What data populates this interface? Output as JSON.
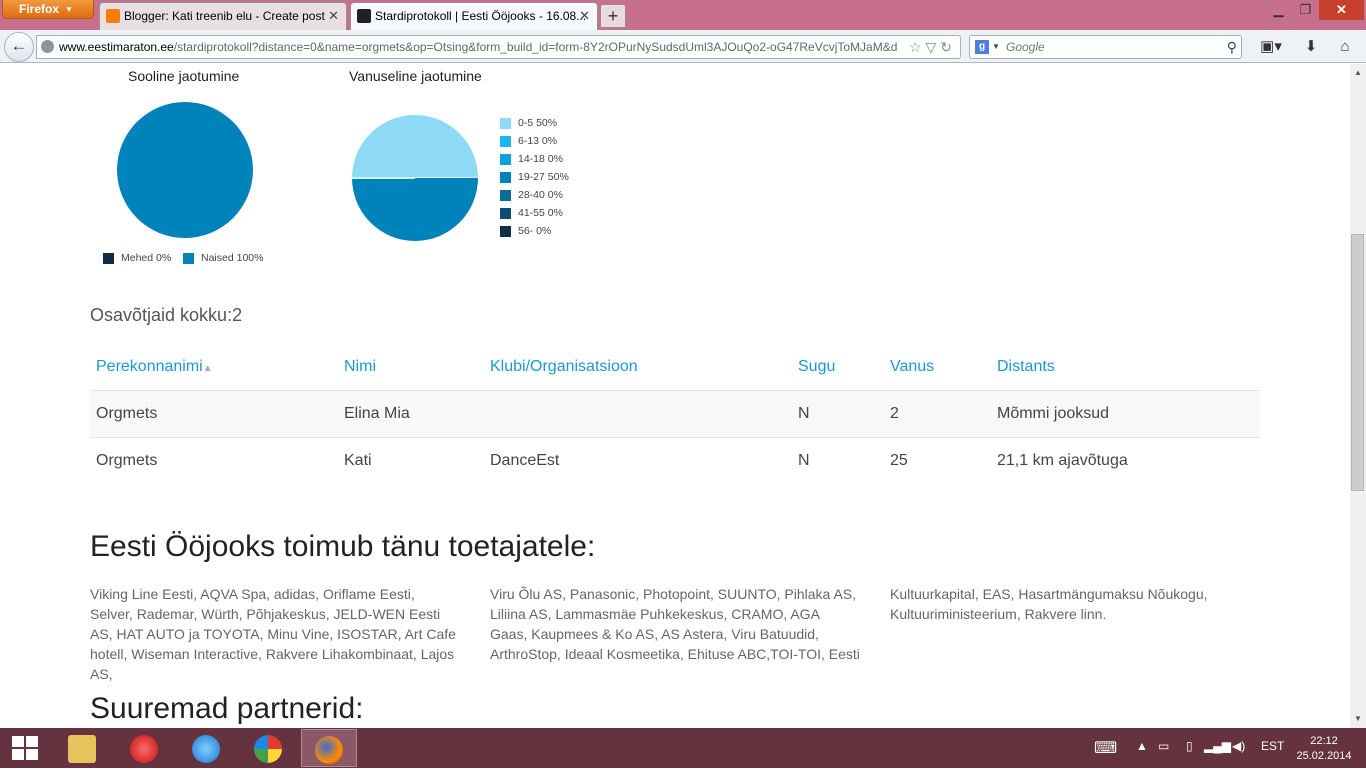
{
  "browser": {
    "app_button": "Firefox",
    "tabs": [
      {
        "title": "Blogger: Kati treenib elu - Create post"
      },
      {
        "title": "Stardiprotokoll | Eesti Ööjooks - 16.08..."
      }
    ],
    "url_host": "www.eestimaraton.ee",
    "url_path": "/stardiprotokoll?distance=0&name=orgmets&op=Otsing&form_build_id=form-8Y2rOPurNySudsdUml3AJOuQo2-oG47ReVcvjToMJaM&d",
    "search_placeholder": "Google"
  },
  "charts": {
    "gender_title": "Sooline jaotumine",
    "age_title": "Vanuseline jaotumine"
  },
  "chart_data": [
    {
      "type": "pie",
      "title": "Sooline jaotumine",
      "labels": [
        "Mehed 0%",
        "Naised 100%"
      ],
      "values": [
        0,
        100
      ],
      "colors": [
        "#0d2b43",
        "#0083ba"
      ],
      "legend": "bottom"
    },
    {
      "type": "pie",
      "title": "Vanuseline jaotumine",
      "labels": [
        "0-5 50%",
        "6-13 0%",
        "14-18 0%",
        "19-27 50%",
        "28-40 0%",
        "41-55 0%",
        "56- 0%"
      ],
      "values": [
        50,
        0,
        0,
        50,
        0,
        0,
        0
      ],
      "colors": [
        "#8dd9f6",
        "#1cb5ee",
        "#0ea3d8",
        "#0083ba",
        "#0b6b9a",
        "#0d4e72",
        "#0c2e49"
      ],
      "legend": "right"
    }
  ],
  "participants_label": "Osavõtjaid kokku:2",
  "table": {
    "headers": [
      "Perekonnanimi",
      "Nimi",
      "Klubi/Organisatsioon",
      "Sugu",
      "Vanus",
      "Distants"
    ],
    "rows": [
      [
        "Orgmets",
        "Elina Mia",
        "",
        "N",
        "2",
        "Mõmmi jooksud"
      ],
      [
        "Orgmets",
        "Kati",
        "DanceEst",
        "N",
        "25",
        "21,1 km ajavõtuga"
      ]
    ]
  },
  "sponsors": {
    "heading": "Eesti Öö­jooks toimub tänu toetajatele:",
    "col1": "Viking Line Eesti, AQVA Spa, adidas, Oriflame Eesti, Selver, Rademar, Würth, Põhjakeskus, JELD-WEN Eesti AS, HAT AUTO ja TOYOTA, Minu Vine, ISOSTAR, Art Cafe hotell, Wiseman Interactive, Rakvere Lihakombinaat, Lajos AS,",
    "col2": "Viru Õlu AS, Panasonic, Photopoint, SUUNTO, Pihlaka AS, Liliina AS, Lammasmäe Puhkekeskus, CRAMO, AGA Gaas, Kaupmees & Ko AS, AS Astera, Viru Batuudid, ArthroStop, Ideaal Kosmeetika, Ehituse ABC,TOI-TOI, Eesti",
    "col3": "Kultuurkapital, EAS, Hasartmängumaksu Nõukogu, Kultuuriministeerium, Rakvere linn."
  },
  "partners_heading": "Suuremad partnerid:",
  "taskbar": {
    "language": "EST",
    "time": "22:12",
    "date": "25.02.2014"
  }
}
